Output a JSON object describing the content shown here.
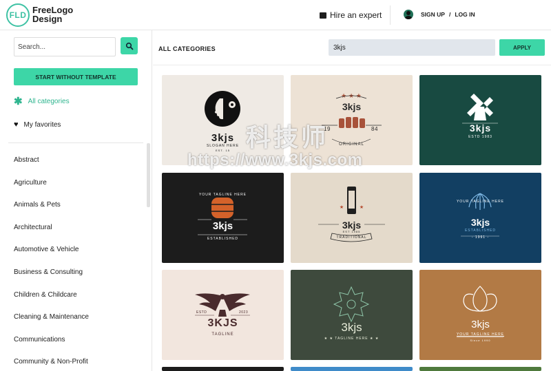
{
  "header": {
    "logo_mark": "FLD",
    "logo_line1": "FreeLogo",
    "logo_line2": "Design",
    "hire_label": "Hire an expert",
    "sign_up": "SIGN UP",
    "slash": "/",
    "log_in": "LOG IN"
  },
  "sidebar": {
    "search_placeholder": "Search...",
    "start_button": "START WITHOUT TEMPLATE",
    "all_categories": "All categories",
    "favorites": "My favorites",
    "categories": [
      "Abstract",
      "Agriculture",
      "Animals & Pets",
      "Architectural",
      "Automotive & Vehicle",
      "Business & Consulting",
      "Children & Childcare",
      "Cleaning & Maintenance",
      "Communications",
      "Community & Non-Profit"
    ]
  },
  "main": {
    "title": "ALL CATEGORIES",
    "search_value": "3kjs",
    "apply_button": "APPLY",
    "cards": [
      {
        "name": "3kjs",
        "slogan": "SLOGAN HERE",
        "small": "EST. 15",
        "bg": "#efeae4",
        "fg": "#1a1a1a",
        "icon": "woman-gear-icon"
      },
      {
        "name": "3kjs",
        "left_year": "19",
        "right_year": "84",
        "bottom": "ORIGINAL",
        "bg": "#ede2d5",
        "fg": "#2b2b2b",
        "accent": "#a8523a",
        "icon": "stars-barrels-icon"
      },
      {
        "name": "3kjs",
        "sub": "ESTD 1983",
        "bg": "#184a41",
        "fg": "#ffffff",
        "icon": "windmill-icon"
      },
      {
        "name": "3kjs",
        "arc": "YOUR TAGLINE HERE",
        "sub": "ESTABLISHED",
        "bg": "#1c1c1c",
        "fg": "#ffffff",
        "accent": "#d4622a",
        "icon": "barrel-icon"
      },
      {
        "name": "3kjs",
        "small": "EST 1985",
        "ribbon": "TRADITIONAL",
        "bg": "#e4dacb",
        "fg": "#1f1f1f",
        "accent": "#b44a2e",
        "icon": "can-icon"
      },
      {
        "name": "3kjs",
        "arc": "YOUR TAGLINE HERE",
        "sub": "ESTABLISHED",
        "year": "- 1991 -",
        "bg": "#123f62",
        "fg": "#ffffff",
        "accent": "#7fb9e6",
        "icon": "palm-icon"
      },
      {
        "name": "3KJS",
        "left": "ESTD",
        "right": "2023",
        "tagline": "TAGLINE",
        "bg": "#f2e6de",
        "fg": "#4a2b2d",
        "icon": "eagle-icon"
      },
      {
        "name": "3kjs",
        "tagline": "★ ★ TAGLINE HERE ★ ★",
        "bg": "#3e4a3d",
        "fg": "#e8ecd9",
        "accent": "#8fc6a9",
        "icon": "star-ornament-icon"
      },
      {
        "name": "3kjs",
        "tagline": "YOUR TAGLINE HERE",
        "small": "Since 1990",
        "bg": "#b27a45",
        "fg": "#ffffff",
        "icon": "lotus-icon"
      }
    ]
  },
  "watermark": {
    "line1": "科技师",
    "line2": "https://www.3kjs.com"
  }
}
